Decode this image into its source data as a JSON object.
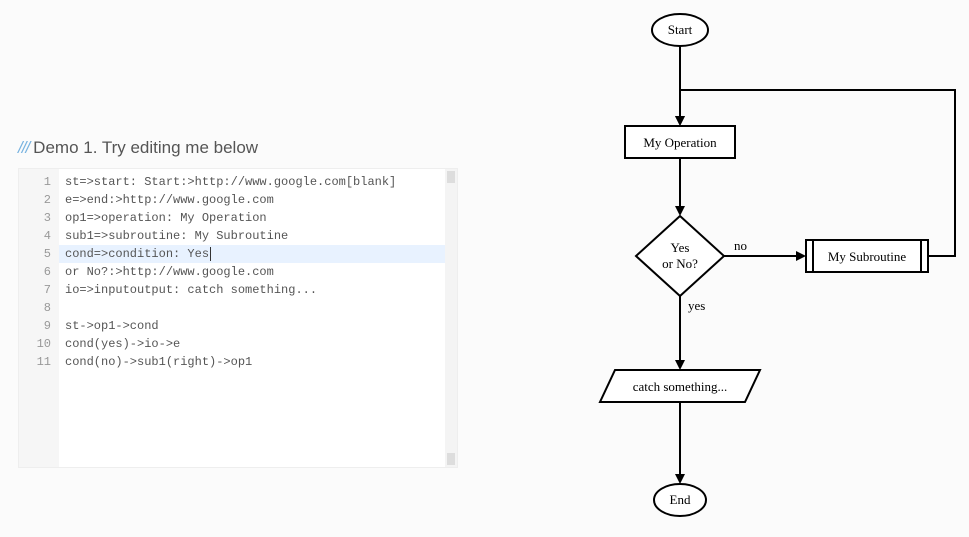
{
  "header": {
    "slashes": "///",
    "title": "Demo 1. Try editing me below"
  },
  "editor": {
    "active_line_index": 4,
    "lines": [
      "st=>start: Start:>http://www.google.com[blank]",
      "e=>end:>http://www.google.com",
      "op1=>operation: My Operation",
      "sub1=>subroutine: My Subroutine",
      "cond=>condition: Yes",
      "or No?:>http://www.google.com",
      "io=>inputoutput: catch something...",
      "",
      "st->op1->cond",
      "cond(yes)->io->e",
      "cond(no)->sub1(right)->op1"
    ],
    "line_numbers": [
      "1",
      "2",
      "3",
      "4",
      "5",
      "6",
      "7",
      "8",
      "9",
      "10",
      "11"
    ]
  },
  "flowchart": {
    "start": "Start",
    "operation": "My Operation",
    "condition_l1": "Yes",
    "condition_l2": "or No?",
    "subroutine": "My Subroutine",
    "io": "catch something...",
    "end": "End",
    "label_yes": "yes",
    "label_no": "no"
  }
}
